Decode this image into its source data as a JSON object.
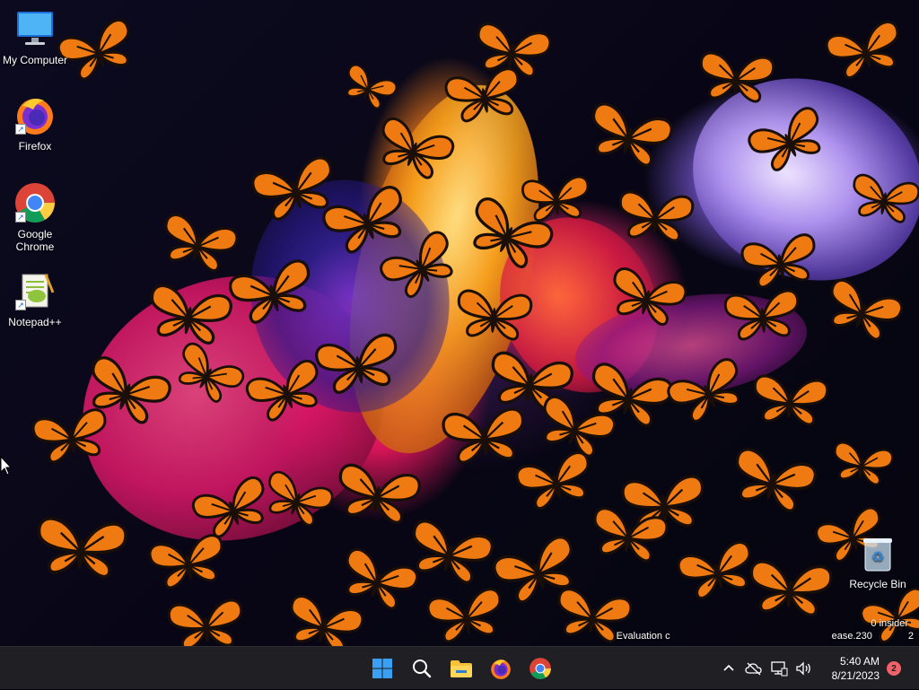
{
  "desktop": {
    "icons": [
      {
        "label": "My Computer",
        "icon": "monitor-icon"
      },
      {
        "label": "Firefox",
        "icon": "firefox-icon"
      },
      {
        "label": "Google Chrome",
        "icon": "chrome-icon"
      },
      {
        "label": "Notepad++",
        "icon": "notepadpp-icon"
      }
    ],
    "recycle_bin": {
      "label": "Recycle Bin",
      "icon": "recycle-bin-icon"
    },
    "watermark": {
      "line1": "0 insider",
      "line2": "Evaluation c",
      "line3": "ease.230",
      "line3_suffix": "2"
    }
  },
  "taskbar": {
    "apps": [
      {
        "name": "start",
        "icon": "windows-logo-icon"
      },
      {
        "name": "search",
        "icon": "search-icon"
      },
      {
        "name": "file-explorer",
        "icon": "folder-icon"
      },
      {
        "name": "firefox",
        "icon": "firefox-icon"
      },
      {
        "name": "chrome",
        "icon": "chrome-icon"
      }
    ],
    "tray": {
      "time": "5:40 AM",
      "date": "8/21/2023",
      "notification_count": "2"
    }
  },
  "colors": {
    "taskbar_bg": "#1f1f24",
    "badge": "#f0616a",
    "butterfly_orange": "#f07a12",
    "butterfly_dark": "#1a0f08"
  }
}
